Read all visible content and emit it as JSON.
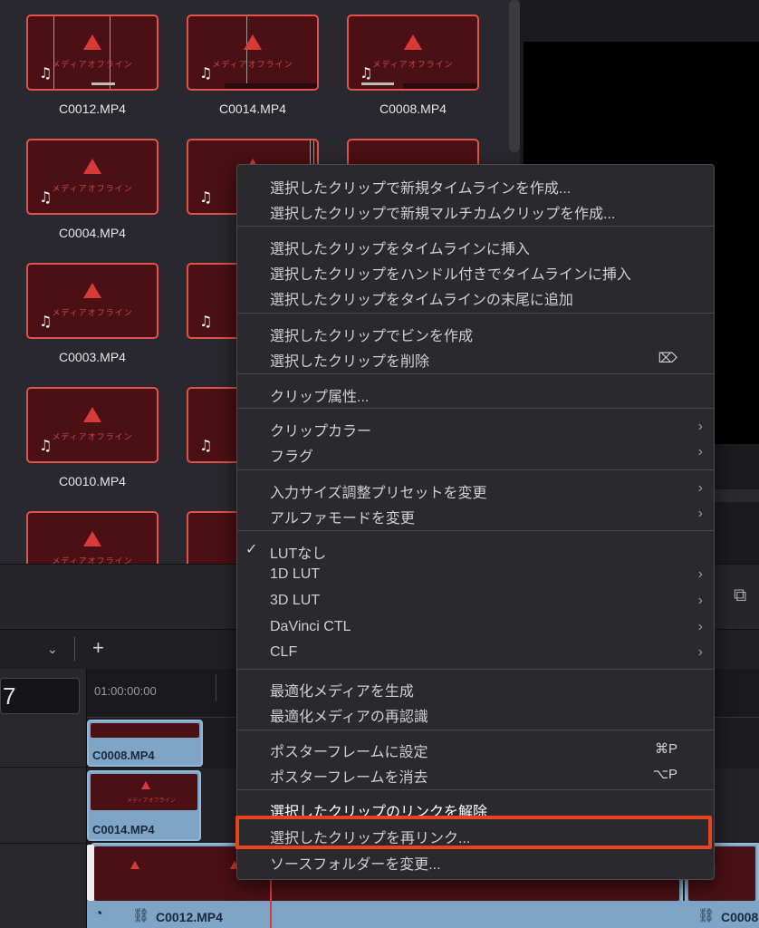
{
  "media_pool": {
    "offline_text": "メディアオフライン",
    "clips": [
      {
        "name": "C0012.MP4"
      },
      {
        "name": "C0014.MP4"
      },
      {
        "name": "C0008.MP4"
      },
      {
        "name": "C0004.MP4"
      },
      {
        "name": "C00"
      },
      {
        "name": ""
      },
      {
        "name": "C0003.MP4"
      },
      {
        "name": "C00"
      },
      {
        "name": "C0010.MP4"
      },
      {
        "name": "C00"
      },
      {
        "name": ""
      },
      {
        "name": ""
      }
    ]
  },
  "timeline": {
    "timecode": "7",
    "ruler_start": "01:00:00:00",
    "dropdown_icon": "chevron-down-icon",
    "add_label": "+",
    "clips": {
      "v_top": "C0008.MP4",
      "v_mid": "C0014.MP4",
      "main": "C0012.MP4",
      "right": "C0008"
    }
  },
  "context_menu": {
    "items": [
      {
        "label": "選択したクリップで新規タイムラインを作成..."
      },
      {
        "label": "選択したクリップで新規マルチカムクリップを作成..."
      },
      {
        "label": "選択したクリップをタイムラインに挿入"
      },
      {
        "label": "選択したクリップをハンドル付きでタイムラインに挿入"
      },
      {
        "label": "選択したクリップをタイムラインの末尾に追加"
      },
      {
        "label": "選択したクリップでビンを作成"
      },
      {
        "label": "選択したクリップを削除",
        "shortcut": "⌦"
      },
      {
        "label": "クリップ属性..."
      },
      {
        "label": "クリップカラー",
        "arrow": "›"
      },
      {
        "label": "フラグ",
        "arrow": "›"
      },
      {
        "label": "入力サイズ調整プリセットを変更",
        "arrow": "›"
      },
      {
        "label": "アルファモードを変更",
        "arrow": "›"
      },
      {
        "label": "LUTなし",
        "check": "✓"
      },
      {
        "label": "1D LUT",
        "arrow": "›"
      },
      {
        "label": "3D LUT",
        "arrow": "›"
      },
      {
        "label": "DaVinci CTL",
        "arrow": "›"
      },
      {
        "label": "CLF",
        "arrow": "›"
      },
      {
        "label": "最適化メディアを生成"
      },
      {
        "label": "最適化メディアの再認識"
      },
      {
        "label": "ポスターフレームに設定",
        "shortcut": "⌘P"
      },
      {
        "label": "ポスターフレームを消去",
        "shortcut": "⌥P"
      },
      {
        "label": "選択したクリップのリンクを解除"
      },
      {
        "label": "選択したクリップを再リンク..."
      },
      {
        "label": "ソースフォルダーを変更..."
      }
    ]
  },
  "colors": {
    "offline_border": "#e0524a",
    "highlight": "#e8421e",
    "timeline_clip": "#7ea4c6"
  }
}
